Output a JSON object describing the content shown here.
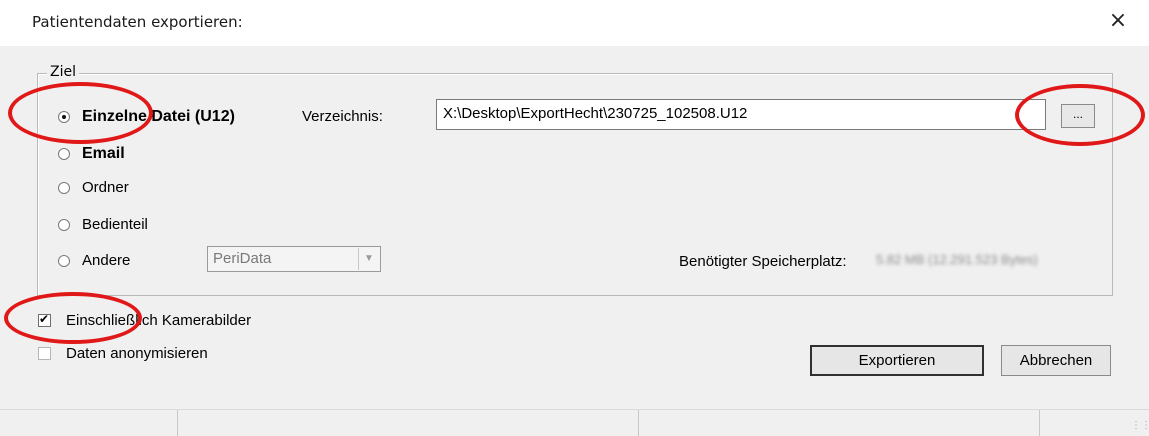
{
  "dialog": {
    "title": "Patientendaten exportieren:",
    "close_glyph": "×"
  },
  "target_group": {
    "legend": "Ziel",
    "options": [
      {
        "label": "Einzelne Datei (U12)",
        "checked": true,
        "bold": true
      },
      {
        "label": "Email",
        "checked": false,
        "bold": true
      },
      {
        "label": "Ordner",
        "checked": false,
        "bold": false
      },
      {
        "label": "Bedienteil",
        "checked": false,
        "bold": false
      },
      {
        "label": "Andere",
        "checked": false,
        "bold": false
      }
    ],
    "directory_label": "Verzeichnis:",
    "directory_value": "X:\\Desktop\\ExportHecht\\230725_102508.U12",
    "browse_label": "...",
    "other_combo_value": "PeriData",
    "storage_label": "Benötigter Speicherplatz:",
    "storage_value": "5.82 MB (12.291.523 Bytes)"
  },
  "options": {
    "include_camera_images": {
      "label": "Einschließlich Kamerabilder",
      "checked": true
    },
    "anonymize": {
      "label": "Daten anonymisieren",
      "checked": false
    }
  },
  "buttons": {
    "export": "Exportieren",
    "cancel": "Abbrechen"
  },
  "colors": {
    "annotation": "#e01818",
    "background": "#f0f0f0"
  },
  "icons": {
    "close": "close-icon",
    "combo_arrow": "chevron-down-icon",
    "grip": "resize-grip-icon"
  }
}
